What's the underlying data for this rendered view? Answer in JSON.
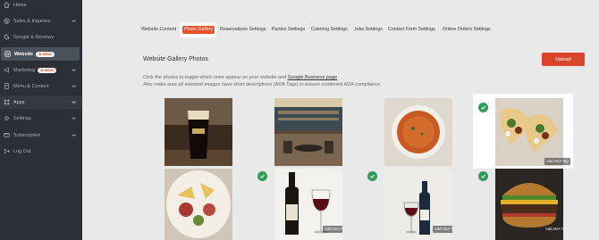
{
  "sidebar": {
    "items": [
      {
        "label": "Home",
        "icon": "home-icon",
        "has_chevron": false
      },
      {
        "label": "Sales & Inquiries",
        "icon": "dollar-icon",
        "has_chevron": true
      },
      {
        "label": "Google & Reviews",
        "icon": "google-icon",
        "has_chevron": false
      },
      {
        "label": "Website",
        "icon": "globe-icon",
        "has_chevron": false,
        "active": true,
        "badge": "NEW!"
      },
      {
        "label": "Marketing",
        "icon": "megaphone-icon",
        "has_chevron": true,
        "badge": "NEW!"
      },
      {
        "label": "Menu & Content",
        "icon": "book-icon",
        "has_chevron": true
      },
      {
        "label": "Apps",
        "icon": "apps-icon",
        "has_chevron": true,
        "highlighted": true
      },
      {
        "label": "Settings",
        "icon": "gear-icon",
        "has_chevron": true
      },
      {
        "label": "Subscription",
        "icon": "card-icon",
        "has_chevron": true
      },
      {
        "label": "Log Out",
        "icon": "logout-icon",
        "has_chevron": false
      }
    ]
  },
  "tabs": [
    {
      "label": "Website Content"
    },
    {
      "label": "Photo Gallery",
      "active": true
    },
    {
      "label": "Reservations Settings"
    },
    {
      "label": "Parties Settings"
    },
    {
      "label": "Catering Settings"
    },
    {
      "label": "Jobs Settings"
    },
    {
      "label": "Contact Form Settings"
    },
    {
      "label": "Online Orders Settings"
    }
  ],
  "gallery": {
    "title": "Website Gallery Photos",
    "upload_label": "Upload",
    "desc_line1_prefix": "Click the photos to toggle which ones appear on your website and",
    "desc_line1_link": "Google Business page",
    "desc_line1_suffix": ".",
    "desc_line2": "Also make sure all selected images have short descriptions (ADA Tags) to ensure continued ADA compliance.",
    "ada_label": "Add ADA Tag",
    "photos": [
      {
        "subject": "stout beer glass",
        "selected": false
      },
      {
        "subject": "restaurant interior",
        "selected": false
      },
      {
        "subject": "tomato soup bowl",
        "selected": false
      },
      {
        "subject": "tacos",
        "selected": true
      },
      {
        "subject": "charcuterie platter",
        "selected": false
      },
      {
        "subject": "red wine bottle and glass",
        "selected": true
      },
      {
        "subject": "wine bottle and glass",
        "selected": true
      },
      {
        "subject": "burger",
        "selected": true
      }
    ]
  },
  "colors": {
    "sidebar_bg": "#2b2f36",
    "accent": "#e8532c",
    "upload": "#d9442b",
    "check": "#2e9e57"
  }
}
